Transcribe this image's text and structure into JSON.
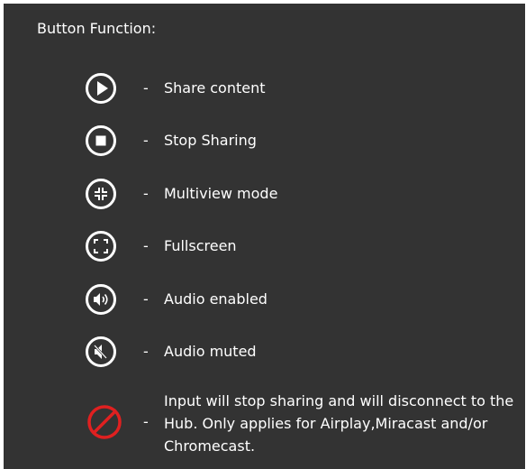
{
  "header": {
    "title": "Button Function:"
  },
  "items": [
    {
      "icon": "play-icon",
      "dash": "-",
      "label": "Share content"
    },
    {
      "icon": "stop-icon",
      "dash": "-",
      "label": "Stop Sharing"
    },
    {
      "icon": "multiview-icon",
      "dash": "-",
      "label": "Multiview mode"
    },
    {
      "icon": "fullscreen-icon",
      "dash": "-",
      "label": "Fullscreen"
    },
    {
      "icon": "audio-enabled-icon",
      "dash": "-",
      "label": "Audio enabled"
    },
    {
      "icon": "audio-muted-icon",
      "dash": "-",
      "label": "Audio muted"
    },
    {
      "icon": "prohibited-icon",
      "dash": "-",
      "label": "Input will stop sharing and will disconnect to the Hub. Only applies for Airplay,Miracast and/or Chromecast."
    }
  ],
  "colors": {
    "background": "#333333",
    "text": "#ffffff",
    "prohibited": "#e02020"
  }
}
